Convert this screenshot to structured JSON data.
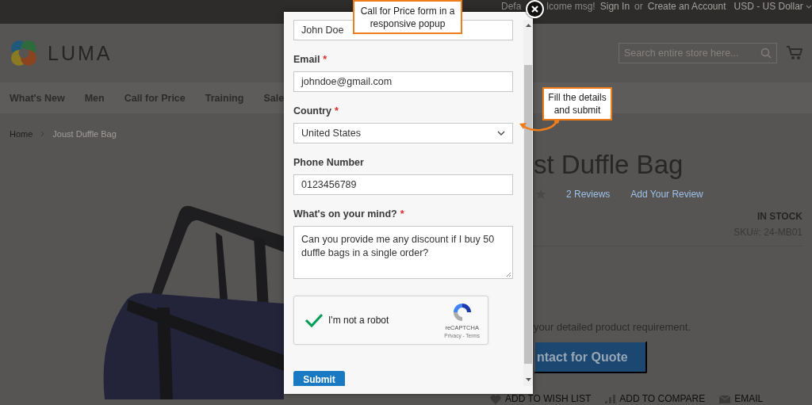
{
  "top_bar": {
    "items": [
      {
        "text": "Defa",
        "kind": "text"
      },
      {
        "text": "lcome msg!",
        "kind": "text"
      },
      {
        "text": "Sign In",
        "kind": "link"
      },
      {
        "text": "or",
        "kind": "text"
      },
      {
        "text": "Create an Account",
        "kind": "link"
      }
    ],
    "currency": "USD - US Dollar"
  },
  "header": {
    "logo_text": "LUMA",
    "search": {
      "placeholder": "Search entire store here..."
    }
  },
  "nav": {
    "items": [
      "What's New",
      "Men",
      "Call for Price",
      "Training",
      "Sale"
    ]
  },
  "breadcrumb": {
    "items": [
      {
        "text": "Home",
        "kind": "link"
      },
      {
        "text": "Joust Duffle Bag",
        "kind": "current"
      }
    ]
  },
  "product": {
    "title": "st Duffle Bag",
    "reviews_link": "2 Reviews",
    "add_review_link": "Add Your Review",
    "stock": "IN STOCK",
    "sku_label": "SKU#:",
    "sku": "24-MB01",
    "note": "your detailed product requirement.",
    "quote_button": "ntact for Quote",
    "actions": [
      {
        "label": "ADD TO WISH LIST",
        "kind": "wishlist"
      },
      {
        "label": "ADD TO COMPARE",
        "kind": "compare"
      },
      {
        "label": "EMAIL",
        "kind": "email"
      }
    ]
  },
  "popup": {
    "fields": [
      {
        "kind": "input",
        "value": "John Doe"
      },
      {
        "kind": "input",
        "label": "Email",
        "required_mark": "*",
        "value": "johndoe@gmail.com"
      },
      {
        "kind": "select",
        "label": "Country",
        "required_mark": "*",
        "value": "United States"
      },
      {
        "kind": "input",
        "label": "Phone Number",
        "value": "0123456789"
      },
      {
        "kind": "textarea",
        "label": "What's on your mind?",
        "required_mark": "*",
        "value": "Can you provide me any discount if I buy 50 duffle bags in a single order?"
      }
    ],
    "captcha": {
      "label": "I'm not a robot",
      "checked": true,
      "brand": "reCAPTCHA",
      "links": "Privacy - Terms"
    },
    "submit": "Submit"
  },
  "annotations": [
    {
      "kind": "top",
      "text": "Call for Price form in a responsive popup"
    },
    {
      "kind": "side",
      "text": "Fill the details and submit"
    }
  ]
}
